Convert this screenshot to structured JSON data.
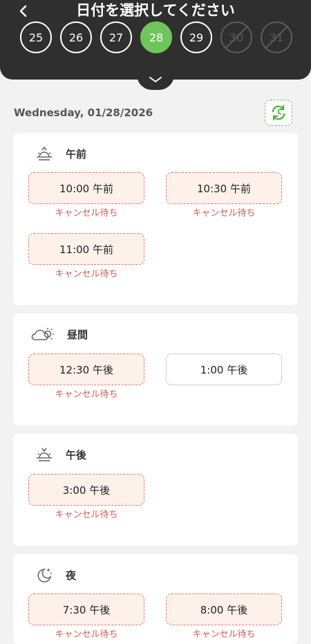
{
  "header": {
    "title": "日付を選択してください",
    "days": [
      {
        "label": "25",
        "state": "normal"
      },
      {
        "label": "26",
        "state": "normal"
      },
      {
        "label": "27",
        "state": "normal"
      },
      {
        "label": "28",
        "state": "selected"
      },
      {
        "label": "29",
        "state": "normal"
      },
      {
        "label": "30",
        "state": "disabled"
      },
      {
        "label": "31",
        "state": "disabled"
      }
    ]
  },
  "date_label": "Wednesday,  01/28/2026",
  "sections": [
    {
      "title": "午前",
      "icon": "sunrise-icon",
      "slots": [
        {
          "time": "10:00 午前",
          "note": "キャンセル待ち"
        },
        {
          "time": "10:30 午前",
          "note": "キャンセル待ち"
        },
        {
          "time": "11:00 午前",
          "note": "キャンセル待ち"
        }
      ]
    },
    {
      "title": "昼間",
      "icon": "cloud-sun-icon",
      "slots": [
        {
          "time": "12:30 午後",
          "note": "キャンセル待ち"
        },
        {
          "time": "1:00 午後",
          "note": ""
        }
      ]
    },
    {
      "title": "午後",
      "icon": "sunset-icon",
      "slots": [
        {
          "time": "3:00 午後",
          "note": "キャンセル待ち"
        }
      ]
    },
    {
      "title": "夜",
      "icon": "moon-stars-icon",
      "slots": [
        {
          "time": "7:30 午後",
          "note": "キャンセル待ち"
        },
        {
          "time": "8:00 午後",
          "note": "キャンセル待ち"
        }
      ]
    }
  ],
  "colors": {
    "header_bg": "#2f2f2f",
    "accent_green": "#6ec65a",
    "waitlist_bg": "#fdf1ea",
    "waitlist_border": "#e07a68",
    "waitlist_text": "#d25a52"
  }
}
